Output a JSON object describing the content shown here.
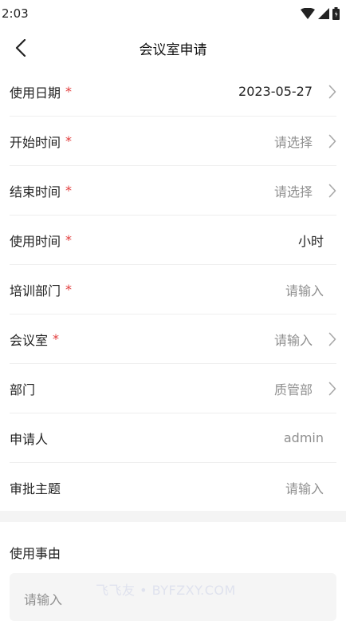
{
  "status": {
    "time": "2:03"
  },
  "header": {
    "title": "会议室申请"
  },
  "form": {
    "rows": [
      {
        "label": "使用日期",
        "required": true,
        "value": "2023-05-27",
        "value_style": "dark",
        "chevron": true
      },
      {
        "label": "开始时间",
        "required": true,
        "value": "请选择",
        "value_style": "placeholder",
        "chevron": true
      },
      {
        "label": "结束时间",
        "required": true,
        "value": "请选择",
        "value_style": "placeholder",
        "chevron": true
      },
      {
        "label": "使用时间",
        "required": true,
        "value": "小时",
        "value_style": "dark",
        "chevron": false
      },
      {
        "label": "培训部门",
        "required": true,
        "value": "请输入",
        "value_style": "placeholder",
        "chevron": false
      },
      {
        "label": "会议室",
        "required": true,
        "value": "请输入",
        "value_style": "placeholder",
        "chevron": true
      },
      {
        "label": "部门",
        "required": false,
        "value": "质管部",
        "value_style": "placeholder",
        "chevron": true
      },
      {
        "label": "申请人",
        "required": false,
        "value": "admin",
        "value_style": "placeholder",
        "chevron": false
      },
      {
        "label": "审批主题",
        "required": false,
        "value": "请输入",
        "value_style": "placeholder",
        "chevron": false
      }
    ],
    "required_mark": "*"
  },
  "reason": {
    "title": "使用事由",
    "placeholder": "请输入"
  },
  "watermark": "飞飞友 • BYFZXY.COM",
  "colors": {
    "required": "#e23b3b",
    "placeholder": "#8f8f8f",
    "text": "#222222",
    "band": "#f4f4f4"
  }
}
